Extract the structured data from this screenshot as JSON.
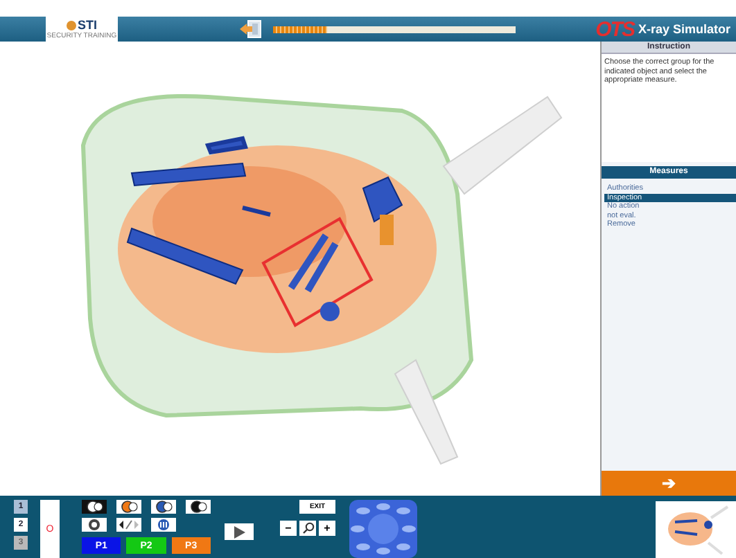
{
  "header": {
    "logo_text": "STI",
    "logo_subtext": "SECURITY TRAINING",
    "progress": {
      "level": 0.22
    },
    "brand": "OTS",
    "title": "X-ray Simulator"
  },
  "instruction": {
    "title": "Instruction",
    "text": "Choose the correct group for the indicated object and select the appropriate measure."
  },
  "measures": {
    "title": "Measures",
    "items": [
      {
        "label": "Authorities",
        "selected": false
      },
      {
        "label": "Inspection",
        "selected": true
      },
      {
        "label": "No action",
        "selected": false
      },
      {
        "label": "not eval.",
        "selected": false
      },
      {
        "label": "Remove",
        "selected": false
      }
    ]
  },
  "next_button": {
    "label": "➔"
  },
  "bottom": {
    "screens": [
      {
        "label": "1",
        "selected": true,
        "disabled": false
      },
      {
        "label": "2",
        "selected": false,
        "disabled": false
      },
      {
        "label": "3",
        "selected": false,
        "disabled": true
      }
    ],
    "marker": "O",
    "profiles": [
      {
        "label": "P1",
        "color": "#0a14e6"
      },
      {
        "label": "P2",
        "color": "#14c814"
      },
      {
        "label": "P3",
        "color": "#f07814"
      }
    ],
    "exit": "EXIT",
    "zoom_out": "−",
    "zoom_in": "+"
  }
}
